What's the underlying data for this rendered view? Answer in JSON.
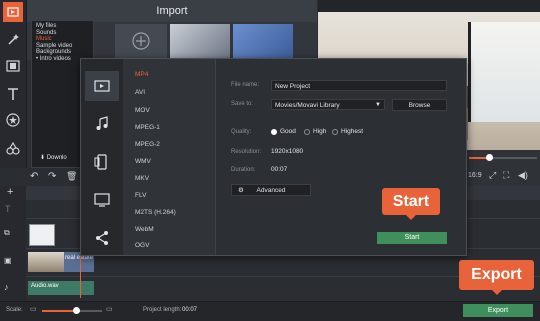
{
  "import_panel": {
    "title": "Import",
    "media_items": [
      "My files",
      "Sounds",
      "Music",
      "Sample video",
      "Backgrounds",
      "• Intro videos"
    ],
    "active_media_index": 2,
    "download_label": "Downlo"
  },
  "dialog": {
    "formats": [
      "MP4",
      "AVI",
      "MOV",
      "MPEG-1",
      "MPEG-2",
      "WMV",
      "MKV",
      "FLV",
      "M2TS (H.264)",
      "WebM",
      "OGV"
    ],
    "active_format_index": 0,
    "file_name_label": "File name:",
    "file_name_value": "New Project",
    "save_to_label": "Save to:",
    "save_to_value": "Movies/Movavi Library",
    "browse_label": "Browse",
    "quality_label": "Quality:",
    "quality_options": [
      "Good",
      "High",
      "Highest"
    ],
    "quality_selected": "Good",
    "resolution_label": "Resolution:",
    "resolution_value": "1920x1080",
    "duration_label": "Duration:",
    "duration_value": "00:07",
    "advanced_label": "Advanced",
    "start_label": "Start"
  },
  "callouts": {
    "start": "Start",
    "export": "Export"
  },
  "preview_controls": {
    "aspect": "16:9"
  },
  "timeline": {
    "video_clip_label": "real estate",
    "audio_clip_label": "Audio.wav"
  },
  "statusbar": {
    "scale_label": "Scale:",
    "project_length_label": "Project length:",
    "project_length_value": "00:07",
    "export_label": "Export"
  },
  "colors": {
    "accent": "#e8633a",
    "green": "#3e8f5b"
  }
}
